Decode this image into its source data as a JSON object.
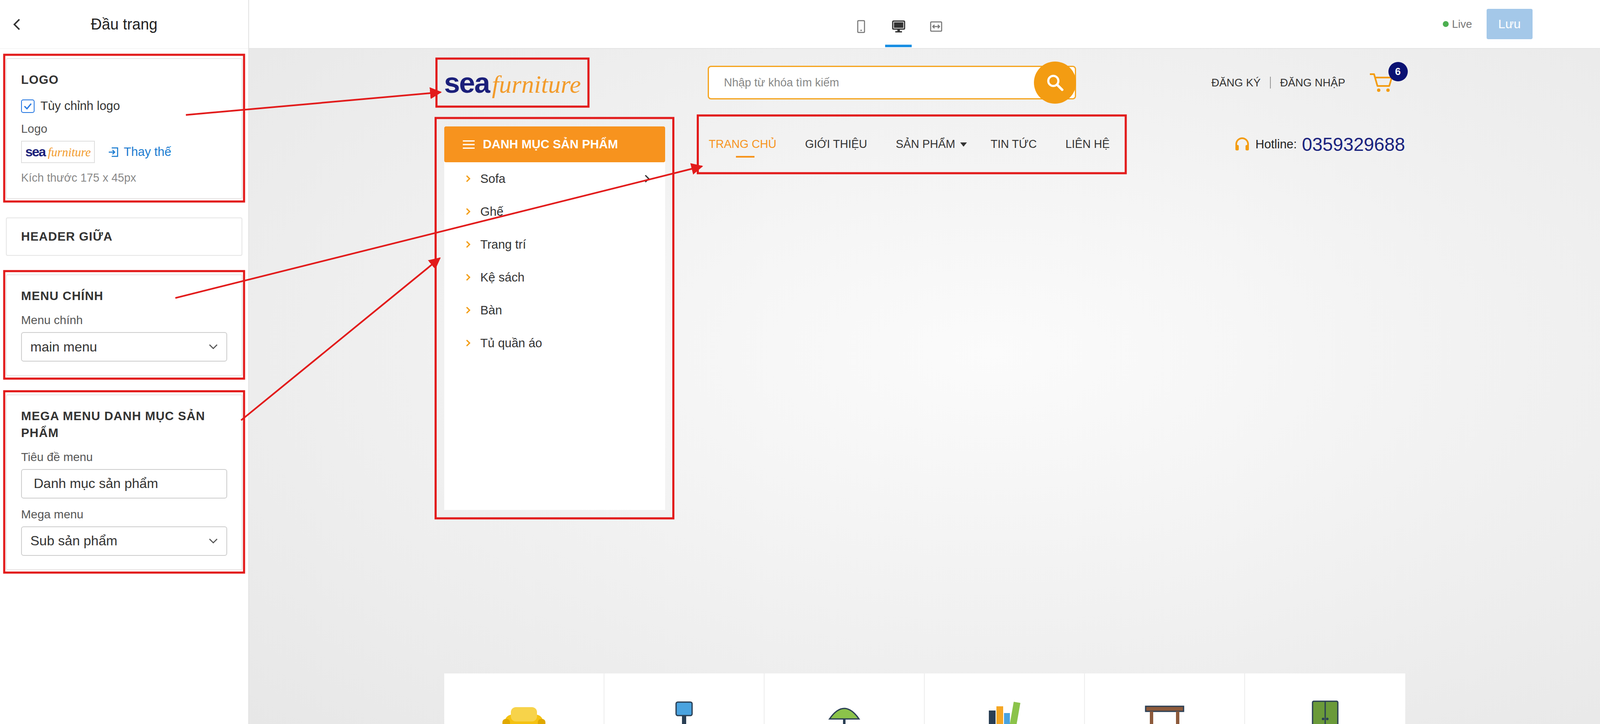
{
  "panel": {
    "title": "Đầu trang"
  },
  "toolbar": {
    "devices": [
      {
        "kind": "mobile",
        "selected": false
      },
      {
        "kind": "desktop",
        "selected": true
      },
      {
        "kind": "fullwidth",
        "selected": false
      }
    ],
    "status": "Live",
    "save": "Lưu"
  },
  "sections": [
    {
      "kind": "logo",
      "title": "LOGO",
      "highlight": true,
      "arrow_to": "logo",
      "checkbox": {
        "label": "Tùy chỉnh logo",
        "checked": true
      },
      "field_label": "Logo",
      "logo": {
        "first": "sea",
        "second": "furniture"
      },
      "replace": "Thay thế",
      "hint": "Kích thước 175 x 45px"
    },
    {
      "kind": "collapsed",
      "title": "HEADER GIỮA",
      "highlight": false,
      "arrow_to": ""
    },
    {
      "kind": "form",
      "title": "MENU CHÍNH",
      "highlight": true,
      "arrow_to": "nav",
      "fields": [
        {
          "kind": "select",
          "label": "Menu chính",
          "value": "main menu"
        }
      ]
    },
    {
      "kind": "form",
      "title": "MEGA MENU DANH MỤC SẢN PHẨM",
      "highlight": true,
      "arrow_to": "category_menu",
      "fields": [
        {
          "kind": "input",
          "label": "Tiêu đề menu",
          "value": "Danh mục sản phẩm"
        },
        {
          "kind": "select",
          "label": "Mega menu",
          "value": "Sub sản phẩm"
        }
      ]
    }
  ],
  "site": {
    "logo": {
      "first": "sea",
      "second": "furniture"
    },
    "search": {
      "placeholder": "Nhập từ khóa tìm kiếm"
    },
    "account": [
      "ĐĂNG KÝ",
      "ĐĂNG NHẬP"
    ],
    "cart": {
      "count": "6"
    },
    "category_menu": {
      "title": "DANH MỤC SẢN PHẨM",
      "items": [
        {
          "label": "Sofa",
          "has_children": true
        },
        {
          "label": "Ghế",
          "has_children": false
        },
        {
          "label": "Trang trí",
          "has_children": false
        },
        {
          "label": "Kệ sách",
          "has_children": false
        },
        {
          "label": "Bàn",
          "has_children": false
        },
        {
          "label": "Tủ quần áo",
          "has_children": false
        }
      ]
    },
    "nav": [
      {
        "label": "TRANG CHỦ",
        "selected": true,
        "has_dropdown": false
      },
      {
        "label": "GIỚI THIỆU",
        "selected": false,
        "has_dropdown": false
      },
      {
        "label": "SẢN PHẨM",
        "selected": false,
        "has_dropdown": true
      },
      {
        "label": "TIN TỨC",
        "selected": false,
        "has_dropdown": false
      },
      {
        "label": "LIÊN HỆ",
        "selected": false,
        "has_dropdown": false
      }
    ],
    "hotline": {
      "label": "Hotline:",
      "number": "0359329688"
    },
    "category_cards": [
      {
        "kind": "sofa"
      },
      {
        "kind": "chair"
      },
      {
        "kind": "lamp"
      },
      {
        "kind": "books"
      },
      {
        "kind": "table"
      },
      {
        "kind": "wardrobe"
      }
    ]
  }
}
